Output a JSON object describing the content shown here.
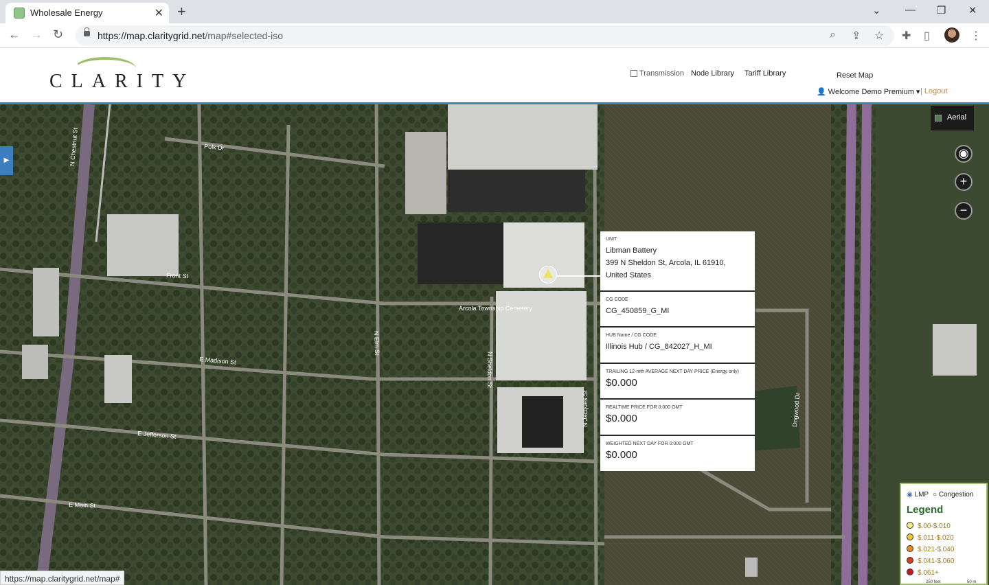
{
  "browser": {
    "tab_title": "Wholesale Energy",
    "url_host": "https://map.claritygrid.net",
    "url_path": "/map#selected-iso"
  },
  "header": {
    "logo_text": "CLARITY",
    "transmission_label": "Transmission",
    "node_library": "Node Library",
    "tariff_library": "Tariff Library",
    "reset_map": "Reset Map",
    "welcome": "Welcome Demo Premium",
    "logout": "| Logout"
  },
  "map": {
    "aerial_label": "Aerial",
    "street_labels": [
      "N Chestnut St",
      "Polk Dr",
      "Front St",
      "E Madison St",
      "E Jefferson St",
      "E Main St",
      "N Elm St",
      "Dogwood Dr",
      "N Sheldon St",
      "N Jacques St",
      "Arcola Township Cemetery"
    ]
  },
  "popup": {
    "unit_label": "UNIT",
    "unit_name": "Libman Battery",
    "unit_address": "399 N Sheldon St, Arcola, IL 61910, United States",
    "cg_code_label": "CG CODE",
    "cg_code": "CG_450859_G_MI",
    "hub_label": "HUB Name / CG CODE",
    "hub_value": "Illinois Hub / CG_842027_H_MI",
    "trailing_label": "TRAILING 12-mth AVERAGE NEXT DAY PRICE (Energy only)",
    "trailing_value": "$0.000",
    "realtime_label": "REALTIME PRICE FOR 0:000 GMT",
    "realtime_value": "$0.000",
    "weighted_label": "WEIGHTED NEXT DAY FOR 0:000 GMT",
    "weighted_value": "$0.000"
  },
  "legend": {
    "lmp_label": "LMP",
    "congestion_label": "Congestion",
    "title": "Legend",
    "items": [
      {
        "label": "$.00-$.010",
        "color": "#f5ec7a"
      },
      {
        "label": "$.011-$.020",
        "color": "#f2c535"
      },
      {
        "label": "$.021-$.040",
        "color": "#e8891e"
      },
      {
        "label": "$.041-$.060",
        "color": "#e03a22"
      },
      {
        "label": "$.061+",
        "color": "#c8161a"
      }
    ],
    "scale_feet": "250 feet",
    "scale_m": "50 m"
  },
  "status_bar": {
    "url": "https://map.claritygrid.net/map#"
  }
}
